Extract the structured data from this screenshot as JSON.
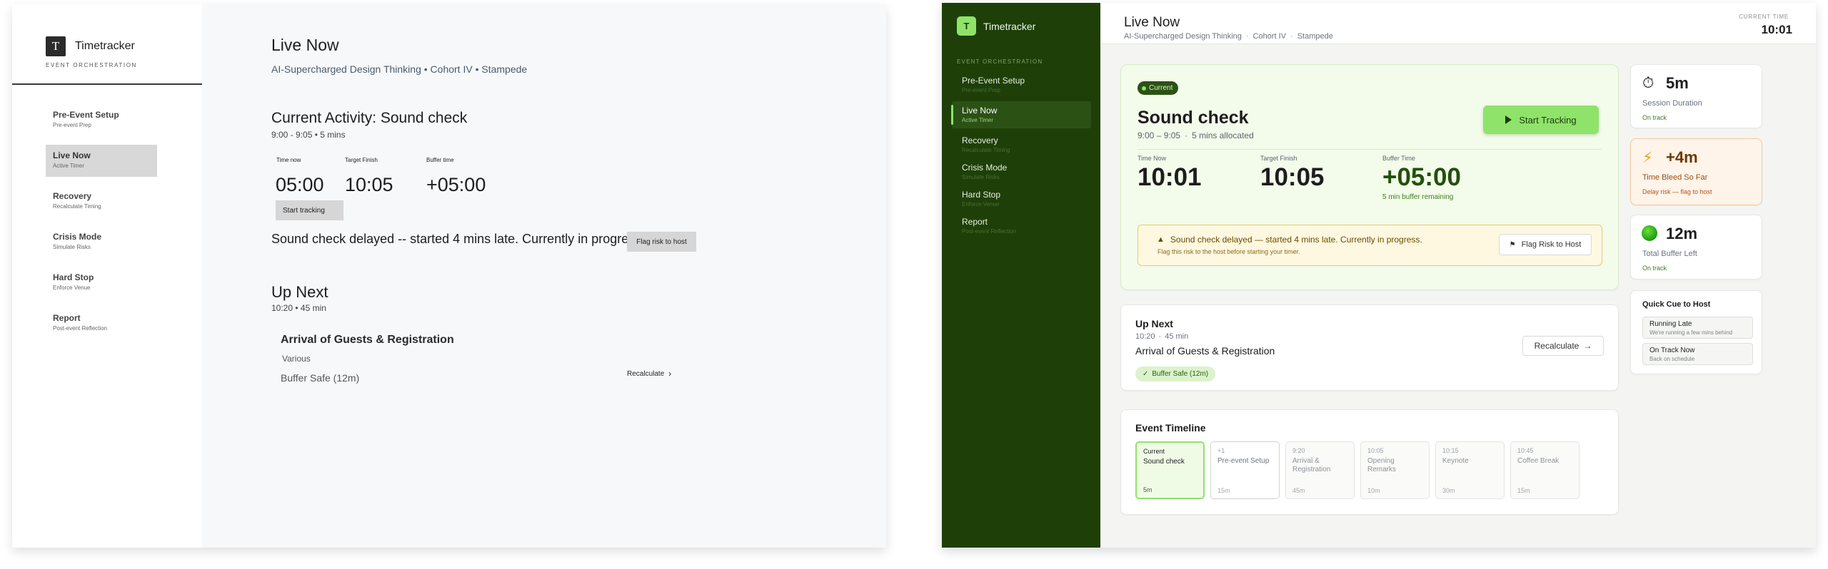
{
  "wireframe": {
    "brand": {
      "logo": "T",
      "name": "Timetracker",
      "subtitle": "Event Orchestration"
    },
    "nav": [
      {
        "label": "Pre-Event Setup",
        "sub": "Pre-event Prep"
      },
      {
        "label": "Live Now",
        "sub": "Active Timer",
        "active": true
      },
      {
        "label": "Recovery",
        "sub": "Recalculate Timing"
      },
      {
        "label": "Crisis Mode",
        "sub": "Simulate Risks"
      },
      {
        "label": "Hard Stop",
        "sub": "Enforce Venue"
      },
      {
        "label": "Report",
        "sub": "Post-event Reflection"
      }
    ],
    "title": "Live Now",
    "subtitle": "AI-Supercharged Design Thinking • Cohort IV • Stampede",
    "activity": {
      "title": "Current Activity: Sound check",
      "meta": "9:00 - 9:05 • 5 mins",
      "labels": {
        "time_now": "Time now",
        "target": "Target Finish",
        "buffer": "Buffer time"
      },
      "values": {
        "time_now": "05:00",
        "target": "10:05",
        "buffer": "+05:00"
      },
      "start_button": "Start tracking"
    },
    "warning": "Sound check delayed -- started 4 mins late. Currently in progress",
    "flag_button": "Flag risk to host",
    "up_next": {
      "title": "Up Next",
      "meta": "10:20 • 45 min",
      "event": "Arrival of Guests & Registration",
      "tag": "Various",
      "buffer": "Buffer Safe (12m)",
      "recalc": "Recalculate"
    }
  },
  "app": {
    "brand": {
      "logo": "T",
      "name": "Timetracker"
    },
    "section": "Event Orchestration",
    "nav": [
      {
        "label": "Pre-Event Setup",
        "sub": "Pre-event Prep"
      },
      {
        "label": "Live Now",
        "sub": "Active Timer",
        "active": true
      },
      {
        "label": "Recovery",
        "sub": "Recalculate Timing"
      },
      {
        "label": "Crisis Mode",
        "sub": "Simulate Risks"
      },
      {
        "label": "Hard Stop",
        "sub": "Enforce Venue"
      },
      {
        "label": "Report",
        "sub": "Post-event Reflection"
      }
    ],
    "header": {
      "title": "Live Now",
      "crumbs": [
        "AI-Supercharged Design Thinking",
        "Cohort IV",
        "Stampede"
      ],
      "time_label": "Current Time",
      "time_value": "10:01"
    },
    "current": {
      "pill": "Current",
      "title": "Sound check",
      "time_range": "9:00 – 9:05",
      "allocated": "5 mins allocated",
      "track_button": "Start Tracking",
      "metrics": [
        {
          "label": "Time Now",
          "value": "10:01"
        },
        {
          "label": "Target Finish",
          "value": "10:05"
        },
        {
          "label": "Buffer Time",
          "value": "+05:00"
        }
      ],
      "buffer_note": "5 min buffer remaining",
      "warning": {
        "title": "Sound check delayed — started 4 mins late. Currently in progress.",
        "sub": "Flag this risk to the host before starting your timer.",
        "button": "Flag Risk to Host"
      }
    },
    "up_next": {
      "title": "Up Next",
      "time": "10:20",
      "duration": "45 min",
      "event": "Arrival of Guests & Registration",
      "badge": "Buffer Safe (12m)",
      "recalc": "Recalculate"
    },
    "timeline": {
      "title": "Event Timeline",
      "items": [
        {
          "time": "Current",
          "name": "Sound check",
          "dur": "5m",
          "state": "current"
        },
        {
          "time": "+1",
          "name": "Pre-event Setup",
          "dur": "15m",
          "state": "next"
        },
        {
          "time": "9:20",
          "name": "Arrival & Registration",
          "dur": "45m"
        },
        {
          "time": "10:05",
          "name": "Opening Remarks",
          "dur": "10m"
        },
        {
          "time": "10:15",
          "name": "Keynote",
          "dur": "30m"
        },
        {
          "time": "10:45",
          "name": "Coffee Break",
          "dur": "15m"
        }
      ]
    },
    "stats": [
      {
        "icon": "⏱",
        "value": "5m",
        "label": "Session Duration",
        "note": "On track"
      },
      {
        "icon": "⚡",
        "value": "+4m",
        "label": "Time Bleed So Far",
        "note": "Delay risk — flag to host"
      },
      {
        "icon": "green-dot",
        "value": "12m",
        "label": "Total Buffer Left",
        "note": "On track"
      }
    ],
    "quick_cue": {
      "title": "Quick Cue to Host",
      "items": [
        {
          "label": "Running Late",
          "sub": "We're running a few mins behind"
        },
        {
          "label": "On Track Now",
          "sub": "Back on schedule"
        }
      ]
    },
    "colors": {
      "sidebar": "#1e4008",
      "accent": "#8fe36a",
      "warning_bg": "#fff8e1"
    }
  }
}
